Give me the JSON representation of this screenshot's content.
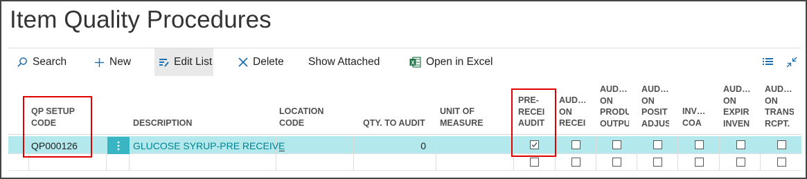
{
  "page": {
    "title": "Item Quality Procedures"
  },
  "toolbar": {
    "search": "Search",
    "new": "New",
    "edit_list": "Edit List",
    "delete": "Delete",
    "show_attached": "Show Attached",
    "open_in_excel": "Open in Excel"
  },
  "columns": {
    "qp_setup_code": "QP SETUP\nCODE",
    "description": "DESCRIPTION",
    "location_code": "LOCATION\nCODE",
    "qty_to_audit": "QTY. TO AUDIT",
    "unit_of_measure": "UNIT OF\nMEASURE",
    "pre_receive_audit": "PRE-\nRECEI\nAUDIT",
    "audit_on_receive": "AUD…\nON\nRECEI",
    "audit_on_production": "AUD…\nON\nPRODU\nOUTPU",
    "audit_on_positive_adj": "AUD…\nON\nPOSIT\nADJUS",
    "inv_coa": "INV…\nCOA",
    "audit_on_expiry": "AUD…\nON\nEXPIR\nINVEN",
    "audit_on_transfer": "AUD…\nON\nTRANS\nRCPT."
  },
  "rows": [
    {
      "qp_setup_code": "QP000126",
      "description": "GLUCOSE SYRUP-PRE RECEIVE",
      "location_code": "_",
      "qty_to_audit": "0",
      "unit_of_measure": "",
      "checks": [
        true,
        false,
        false,
        false,
        false,
        false,
        false
      ]
    },
    {
      "qp_setup_code": "",
      "description": "",
      "location_code": "",
      "qty_to_audit": "",
      "unit_of_measure": "",
      "checks": [
        false,
        false,
        false,
        false,
        false,
        false,
        false
      ]
    }
  ],
  "colors": {
    "selected_row": "#b3e8ec",
    "accent": "#00838f",
    "highlight_box": "#e00000",
    "excel_green": "#1e7145"
  }
}
